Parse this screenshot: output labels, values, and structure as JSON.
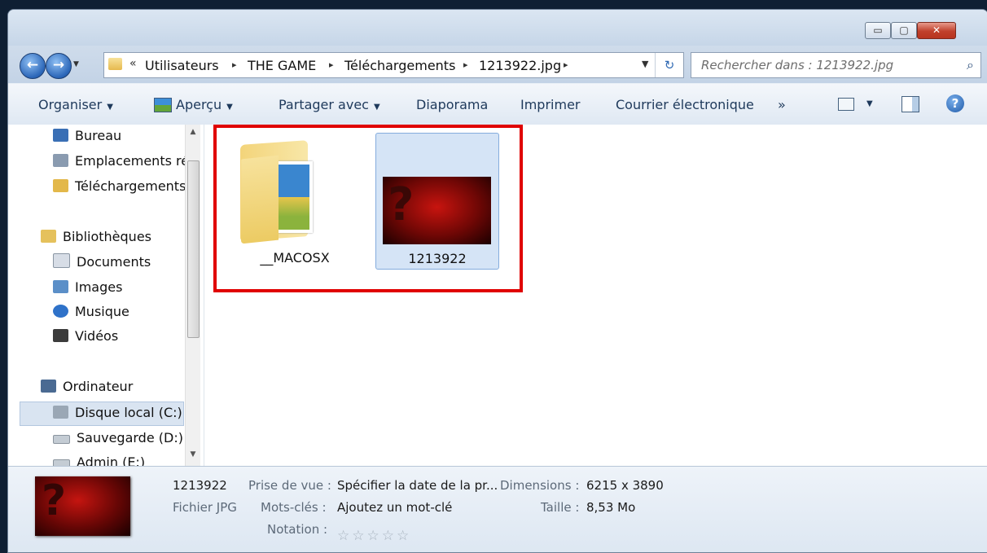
{
  "window": {
    "buttons": {
      "minimize": "▭",
      "maximize": "▢",
      "close": "✕"
    }
  },
  "nav": {
    "back_glyph": "←",
    "forward_glyph": "→",
    "address": {
      "overflow_chevron": "«",
      "crumbs": [
        "Utilisateurs",
        "THE GAME",
        "Téléchargements",
        "1213922.jpg"
      ],
      "separator": "▸"
    },
    "refresh_glyph": "↻",
    "search": {
      "placeholder": "Rechercher dans : 1213922.jpg"
    }
  },
  "toolbar": {
    "organiser": "Organiser",
    "apercu": "Aperçu",
    "partager": "Partager avec",
    "diaporama": "Diaporama",
    "imprimer": "Imprimer",
    "courrier": "Courrier électronique",
    "more": "»",
    "dropdown_arrow": "▼",
    "help_glyph": "?"
  },
  "sidebar": {
    "items": [
      {
        "label": "Bureau",
        "icon": "desktop-icon",
        "color": "#3a6fb5"
      },
      {
        "label": "Emplacements ré",
        "icon": "recent-places-icon",
        "color": "#8a9bb0"
      },
      {
        "label": "Téléchargements",
        "icon": "downloads-folder-icon",
        "color": "#e3b84a"
      },
      {
        "label": "Bibliothèques",
        "icon": "libraries-icon",
        "color": "#e5c15c"
      },
      {
        "label": "Documents",
        "icon": "documents-icon",
        "color": "#d7dde6"
      },
      {
        "label": "Images",
        "icon": "pictures-icon",
        "color": "#5b8fc8"
      },
      {
        "label": "Musique",
        "icon": "music-icon",
        "color": "#2f72c9"
      },
      {
        "label": "Vidéos",
        "icon": "videos-icon",
        "color": "#3c3c3c"
      },
      {
        "label": "Ordinateur",
        "icon": "computer-icon",
        "color": "#4a6a92"
      },
      {
        "label": "Disque local (C:)",
        "icon": "local-disk-icon",
        "color": "#9aa7b5"
      },
      {
        "label": "Sauvegarde (D:)",
        "icon": "drive-icon",
        "color": "#c4ccd4"
      },
      {
        "label": "Admin (E:)",
        "icon": "drive-icon",
        "color": "#c4ccd4"
      }
    ],
    "selected": "Disque local (C:)"
  },
  "files": [
    {
      "name": "__MACOSX",
      "type": "folder"
    },
    {
      "name": "1213922",
      "type": "jpg",
      "selected": true
    }
  ],
  "details": {
    "name": "1213922",
    "type": "Fichier JPG",
    "prise_de_vue_label": "Prise de vue :",
    "prise_de_vue_value": "Spécifier la date de la pr...",
    "mots_cles_label": "Mots-clés :",
    "mots_cles_value": "Ajoutez un mot-clé",
    "notation_label": "Notation :",
    "notation_value": 0,
    "notation_stars": "☆☆☆☆☆",
    "dimensions_label": "Dimensions :",
    "dimensions_value": "6215 x 3890",
    "taille_label": "Taille :",
    "taille_value": "8,53 Mo"
  },
  "colors": {
    "highlight_box": "#e00000",
    "selection": "#d5e4f6"
  }
}
